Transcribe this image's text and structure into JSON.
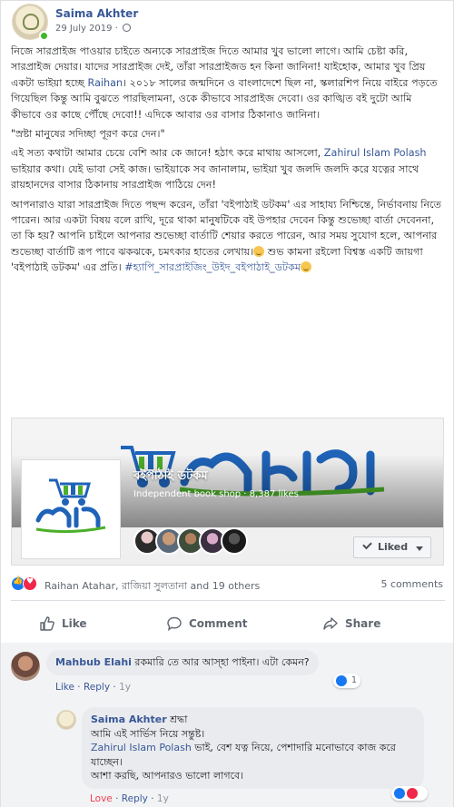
{
  "post": {
    "author": "Saima Akhter",
    "date": "29 July 2019",
    "privacy_icon": "globe-icon",
    "body": [
      {
        "segments": [
          {
            "text": "নিজে সারপ্রাইজ পাওয়ার চাইতে অন্যকে সারপ্রাইজ দিতে আমার খুব ভালো লাগে। আমি চেষ্টা করি, সারপ্রাইজ দেয়ার। যাদের সারপ্রাইজ দেই, তাঁরা সারপ্রাইজড হন কিনা জানিনা! যাইহোক, আমার খুব প্রিয় একটা ভাইয়া হচ্ছে "
          },
          {
            "text": "Raihan",
            "link": true
          },
          {
            "text": "। ২০১৮ সালের জন্মদিনে ও বাংলাদেশে ছিল না, স্কলারশিপ নিয়ে বাইরে পড়তে গিয়েছিল কিন্তু আমি বুঝতে পারছিলামনা, ওকে কীভাবে সারপ্রাইজ দেবো। ওর কাঙ্খিত বই দুটো আমি কীভাবে ওর কাছে পৌঁছে দেবো!! এদিকে আবার ওর বাসার ঠিকানাও জানিনা।"
          }
        ]
      },
      {
        "segments": [
          {
            "text": "\"স্রষ্টা মানুষের সদিচ্ছা পূরণ করে দেন।\""
          }
        ]
      },
      {
        "segments": [
          {
            "text": "এই সত্য কথাটা আমার চেয়ে বেশি আর কে জানে! হঠাৎ করে মাথায় আসলো, "
          },
          {
            "text": "Zahirul Islam Polash",
            "link": true
          },
          {
            "text": " ভাইয়ার কথা। যেই ভাবা সেই কাজ। ভাইয়াকে সব জানালাম, ভাইয়া খুব জলদি জলদি করে যত্নের সাথে রায়হানদের বাসার ঠিকানায় সারপ্রাইজ পাঠিয়ে দেন!"
          }
        ]
      },
      {
        "segments": [
          {
            "text": "আপনারাও যারা সারপ্রাইজ দিতে পছন্দ করেন, তাঁরা 'বইপাঠাই ডটকম' এর সাহায্য নিশ্চিন্তে, নির্ভাবনায় নিতে পারেন। আর একটা বিষয় বলে রাখি, দূরে থাকা মানুষটিকে বই উপহার দেবেন কিন্তু শুভেচ্ছা বার্তা দেবেননা, তা কি হয়? আপনি চাইলে আপনার শুভেচ্ছা বার্তাটি শেয়ার করতে পারেন, আর সময় সুযোগ হলে, আপনার শুভেচ্ছা বার্তাটি রূপ পাবে ঝকঝকে, চমৎকার হাতের লেখায়।"
          },
          {
            "emoji": "smile-emoji"
          },
          {
            "text": " শুভ কামনা রইলো বিশ্বস্ত একটি জায়গা 'বইপাঠাই ডটকম' এর প্রতি। "
          },
          {
            "text": "#হ্যাপি_সারপ্রাইজিং_উইদ_বইপাঠাই_ডটকম",
            "link": true
          },
          {
            "emoji": "smile-emoji"
          }
        ]
      }
    ]
  },
  "shared_page": {
    "name": "বইপাঠাই ডটকম",
    "subtitle": "Independent book shop · 8,387 likes",
    "liked_label": "Liked",
    "logo_text": "বইপাঠাই",
    "logo_side_text": "ডটকম",
    "brand_blue": "#1f63b8",
    "brand_green": "#4caf2a"
  },
  "reactions": {
    "names": "Raihan Atahar, রাজিয়া সুলতানা and 19 others",
    "comments_count": "5 comments",
    "like_color": "#1877f2",
    "love_color": "#f0284a"
  },
  "actions": {
    "like": "Like",
    "comment": "Comment",
    "share": "Share"
  },
  "comments": [
    {
      "author": "Mahbub Elahi",
      "text": " রকমারি তে আর আস্হা পাইনা। এটা কেমন?",
      "like_label": "Like",
      "reply_label": "Reply",
      "time": "1y",
      "reaction_count": "1"
    },
    {
      "author": "Saima Akhter",
      "line1": " শ্রদ্ধা",
      "line2": "আমি এই সার্ভিস নিয়ে সন্তুষ্ট।",
      "mention": "Zahirul Islam Polash",
      "line3": " ভাই, বেশ যত্ন নিয়ে, পেশাদারি মনোভাবে কাজ করে যাচ্ছেন।",
      "line4": "আশা করছি, আপনারও ভালো লাগবে।",
      "love_label": "Love",
      "reply_label": "Reply",
      "time": "1y"
    }
  ]
}
